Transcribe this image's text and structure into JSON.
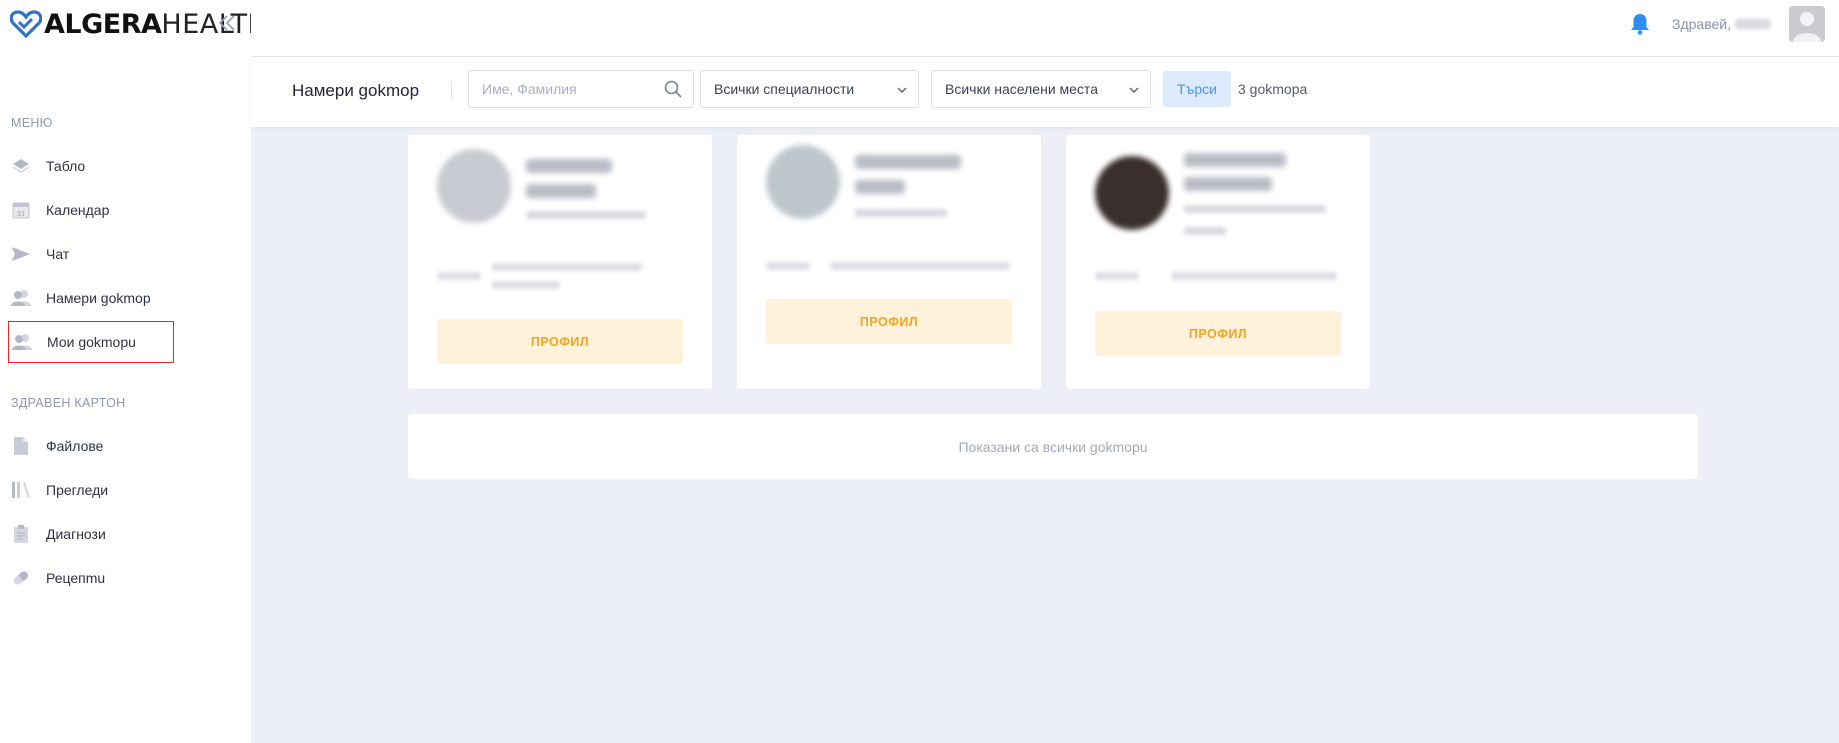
{
  "app": {
    "logo_bold": "ALGERA",
    "logo_light": "HEALTH"
  },
  "header": {
    "greeting": "Здравей,"
  },
  "sidebar": {
    "sections": [
      {
        "heading": "МЕНЮ"
      },
      {
        "heading": "ЗДРАВЕН КАРТОН"
      }
    ],
    "items": [
      {
        "label": "Табло",
        "icon": "dashboard-icon"
      },
      {
        "label": "Календар",
        "icon": "calendar-icon"
      },
      {
        "label": "Чат",
        "icon": "send-icon"
      },
      {
        "label": "Намери gokmop",
        "icon": "users-icon"
      },
      {
        "label": "Мои gokmopu",
        "icon": "users-icon",
        "active": true
      },
      {
        "label": "Файлове",
        "icon": "file-icon"
      },
      {
        "label": "Прегледи",
        "icon": "books-icon"
      },
      {
        "label": "Диагнози",
        "icon": "clipboard-icon"
      },
      {
        "label": "Рецепmu",
        "icon": "pill-icon"
      }
    ],
    "calendar_day": "31"
  },
  "search": {
    "title": "Намери gokmop",
    "placeholder": "Име, Фамилия",
    "specialty": "Всички специалности",
    "city": "Всички населени места",
    "button": "Търси",
    "count": "3 gokmopa"
  },
  "cards": [
    {
      "button": "ПРОФИЛ"
    },
    {
      "button": "ПРОФИЛ"
    },
    {
      "button": "ПРОФИЛ"
    }
  ],
  "footer_message": "Показани са всички gokmopu",
  "colors": {
    "accent_blue": "#2f8ef0",
    "profile_bg": "#fff1da",
    "profile_text": "#f2a51d",
    "active_border": "#e02a2a"
  }
}
